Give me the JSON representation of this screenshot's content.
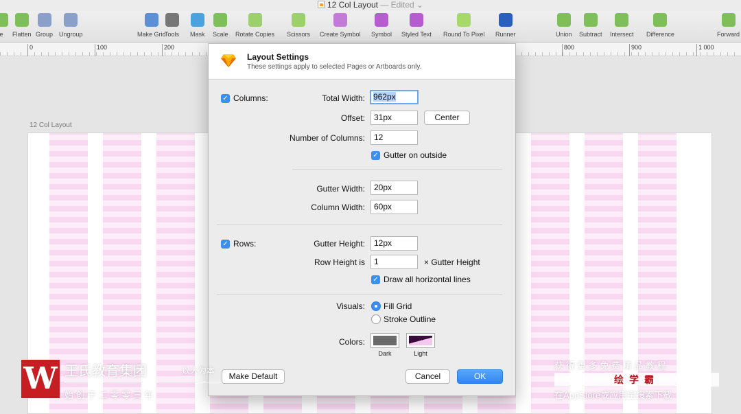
{
  "window": {
    "title": "12 Col Layout",
    "edited_suffix": "— Edited",
    "chevron": "⌄"
  },
  "toolbar": {
    "items": [
      {
        "label": "e",
        "icon": "edit-icon",
        "color": "#7fbf5a"
      },
      {
        "label": "Flatten",
        "icon": "flatten-icon",
        "color": "#7fbf5a"
      },
      {
        "label": "Group",
        "icon": "group-icon",
        "color": "#8aa0c8"
      },
      {
        "label": "Ungroup",
        "icon": "ungroup-icon",
        "color": "#8aa0c8"
      },
      {
        "label": "Make Grid",
        "icon": "make-grid-icon",
        "color": "#5d8fd6"
      },
      {
        "label": "Tools",
        "icon": "tools-icon",
        "color": "#777777"
      },
      {
        "label": "Mask",
        "icon": "mask-icon",
        "color": "#4aa3df"
      },
      {
        "label": "Scale",
        "icon": "scale-icon",
        "color": "#7fbf5a"
      },
      {
        "label": "Rotate Copies",
        "icon": "rotate-copies-icon",
        "color": "#9bd06a"
      },
      {
        "label": "Scissors",
        "icon": "scissors-icon",
        "color": "#9bd06a"
      },
      {
        "label": "Create Symbol",
        "icon": "create-symbol-icon",
        "color": "#c27bd6"
      },
      {
        "label": "Symbol",
        "icon": "symbol-icon",
        "color": "#b45cd0"
      },
      {
        "label": "Styled Text",
        "icon": "styled-text-icon",
        "color": "#b45cd0"
      },
      {
        "label": "Round To Pixel",
        "icon": "round-to-pixel-icon",
        "color": "#a6d86a"
      },
      {
        "label": "Runner",
        "icon": "runner-icon",
        "color": "#2a5fbf"
      },
      {
        "label": "Union",
        "icon": "union-icon",
        "color": "#7fbf5a"
      },
      {
        "label": "Subtract",
        "icon": "subtract-icon",
        "color": "#7fbf5a"
      },
      {
        "label": "Intersect",
        "icon": "intersect-icon",
        "color": "#7fbf5a"
      },
      {
        "label": "Difference",
        "icon": "difference-icon",
        "color": "#7fbf5a"
      },
      {
        "label": "Forward",
        "icon": "forward-icon",
        "color": "#7fbf5a"
      }
    ]
  },
  "ruler": {
    "marks": [
      "0",
      "100",
      "200",
      "800",
      "900",
      "1 000"
    ]
  },
  "canvas": {
    "artboard_label": "12 Col Layout",
    "grid_color": "#f8d7f0"
  },
  "dialog": {
    "title": "Layout Settings",
    "subtitle": "These settings apply to selected Pages or Artboards only.",
    "columns": {
      "checkbox_label": "Columns:",
      "total_width_label": "Total Width:",
      "total_width_value": "962px",
      "offset_label": "Offset:",
      "offset_value": "31px",
      "center_button": "Center",
      "number_label": "Number of Columns:",
      "number_value": "12",
      "gutter_outside_label": "Gutter on outside",
      "gutter_width_label": "Gutter Width:",
      "gutter_width_value": "20px",
      "column_width_label": "Column Width:",
      "column_width_value": "60px"
    },
    "rows": {
      "checkbox_label": "Rows:",
      "gutter_height_label": "Gutter Height:",
      "gutter_height_value": "12px",
      "row_height_label": "Row Height is",
      "row_height_value": "1",
      "row_height_suffix": "× Gutter Height",
      "draw_lines_label": "Draw all horizontal lines"
    },
    "visuals": {
      "label": "Visuals:",
      "fill_grid": "Fill Grid",
      "stroke_outline": "Stroke Outline"
    },
    "colors": {
      "label": "Colors:",
      "dark": "Dark",
      "light": "Light",
      "dark_color": "#6b6b6b",
      "light_color": "#3a0a3a"
    },
    "buttons": {
      "make_default": "Make Default",
      "cancel": "Cancel",
      "ok": "OK"
    }
  },
  "watermark": {
    "logo": "W",
    "company": "王氏教育集团",
    "slogan": "以人为本",
    "founded": "始 创 于 二 零 零 三 年",
    "right_top": "获 得 更 多 免 费 精 品 教 程",
    "right_brand": "绘学霸",
    "right_bottom": "在AppStore或应用宝搜索下载"
  }
}
